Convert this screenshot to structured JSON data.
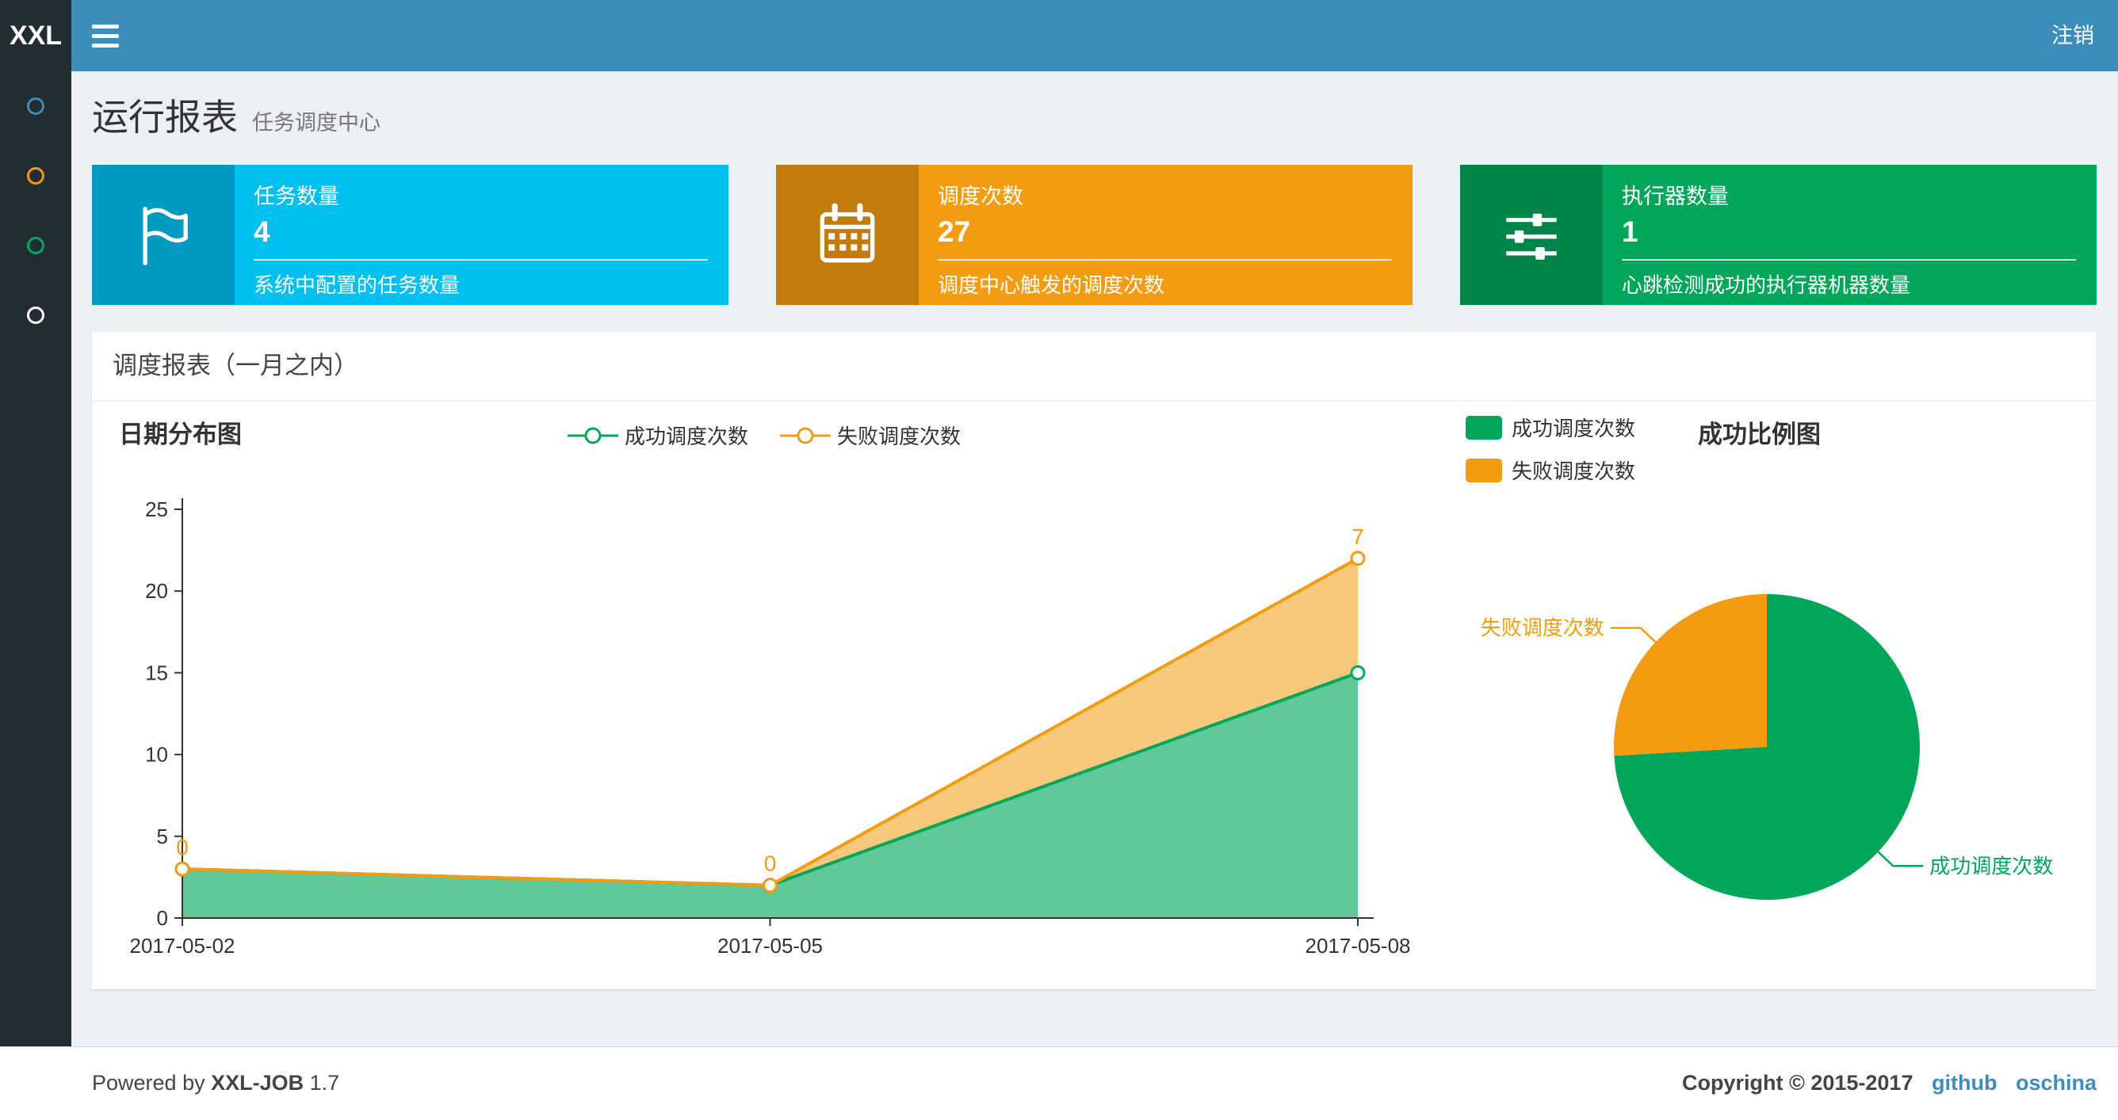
{
  "navbar": {
    "logo_text": "XXL",
    "logout_label": "注销"
  },
  "sidebar": {
    "items": [
      {
        "id": "menu-1",
        "icon_color": "#3c8dbc"
      },
      {
        "id": "menu-2",
        "icon_color": "#f39c12"
      },
      {
        "id": "menu-3",
        "icon_color": "#00a65a"
      },
      {
        "id": "menu-4",
        "icon_color": "#ffffff"
      }
    ]
  },
  "page_header": {
    "title": "运行报表",
    "subtitle": "任务调度中心"
  },
  "info_boxes": [
    {
      "icon": "flag-icon",
      "title": "任务数量",
      "value": "4",
      "desc": "系统中配置的任务数量",
      "color": "#00c0ef"
    },
    {
      "icon": "calendar-icon",
      "title": "调度次数",
      "value": "27",
      "desc": "调度中心触发的调度次数",
      "color": "#f39c12"
    },
    {
      "icon": "sliders-icon",
      "title": "执行器数量",
      "value": "1",
      "desc": "心跳检测成功的执行器机器数量",
      "color": "#00a65a"
    }
  ],
  "panel": {
    "title": "调度报表（一月之内）"
  },
  "chart_data": [
    {
      "type": "area",
      "title": "日期分布图",
      "x": [
        "2017-05-02",
        "2017-05-05",
        "2017-05-08"
      ],
      "stacked": true,
      "series": [
        {
          "name": "成功调度次数",
          "values": [
            3,
            2,
            15
          ],
          "color": "#00a65a"
        },
        {
          "name": "失败调度次数",
          "values": [
            0,
            0,
            7
          ],
          "color": "#f39c12"
        }
      ],
      "point_labels": {
        "series": "失败调度次数",
        "values": [
          "0",
          "0",
          "7"
        ]
      },
      "ylim": [
        0,
        25
      ],
      "yticks": [
        0,
        5,
        10,
        15,
        20,
        25
      ],
      "legend_position": "top",
      "grid": false
    },
    {
      "type": "pie",
      "title": "成功比例图",
      "slices": [
        {
          "name": "成功调度次数",
          "value": 20,
          "color": "#00a65a"
        },
        {
          "name": "失败调度次数",
          "value": 7,
          "color": "#f39c12"
        }
      ],
      "legend_position": "top-left"
    }
  ],
  "footer": {
    "powered_by_prefix": "Powered by",
    "product": "XXL-JOB",
    "version": "1.7",
    "copyright": "Copyright © 2015-2017",
    "links": [
      {
        "label": "github"
      },
      {
        "label": "oschina"
      }
    ]
  },
  "colors": {
    "navbar": "#3c8dbc",
    "sidebar": "#222d32",
    "content_bg": "#ecf0f5",
    "success": "#00a65a",
    "warning": "#f39c12",
    "info": "#00c0ef",
    "link": "#3c8dbc"
  }
}
